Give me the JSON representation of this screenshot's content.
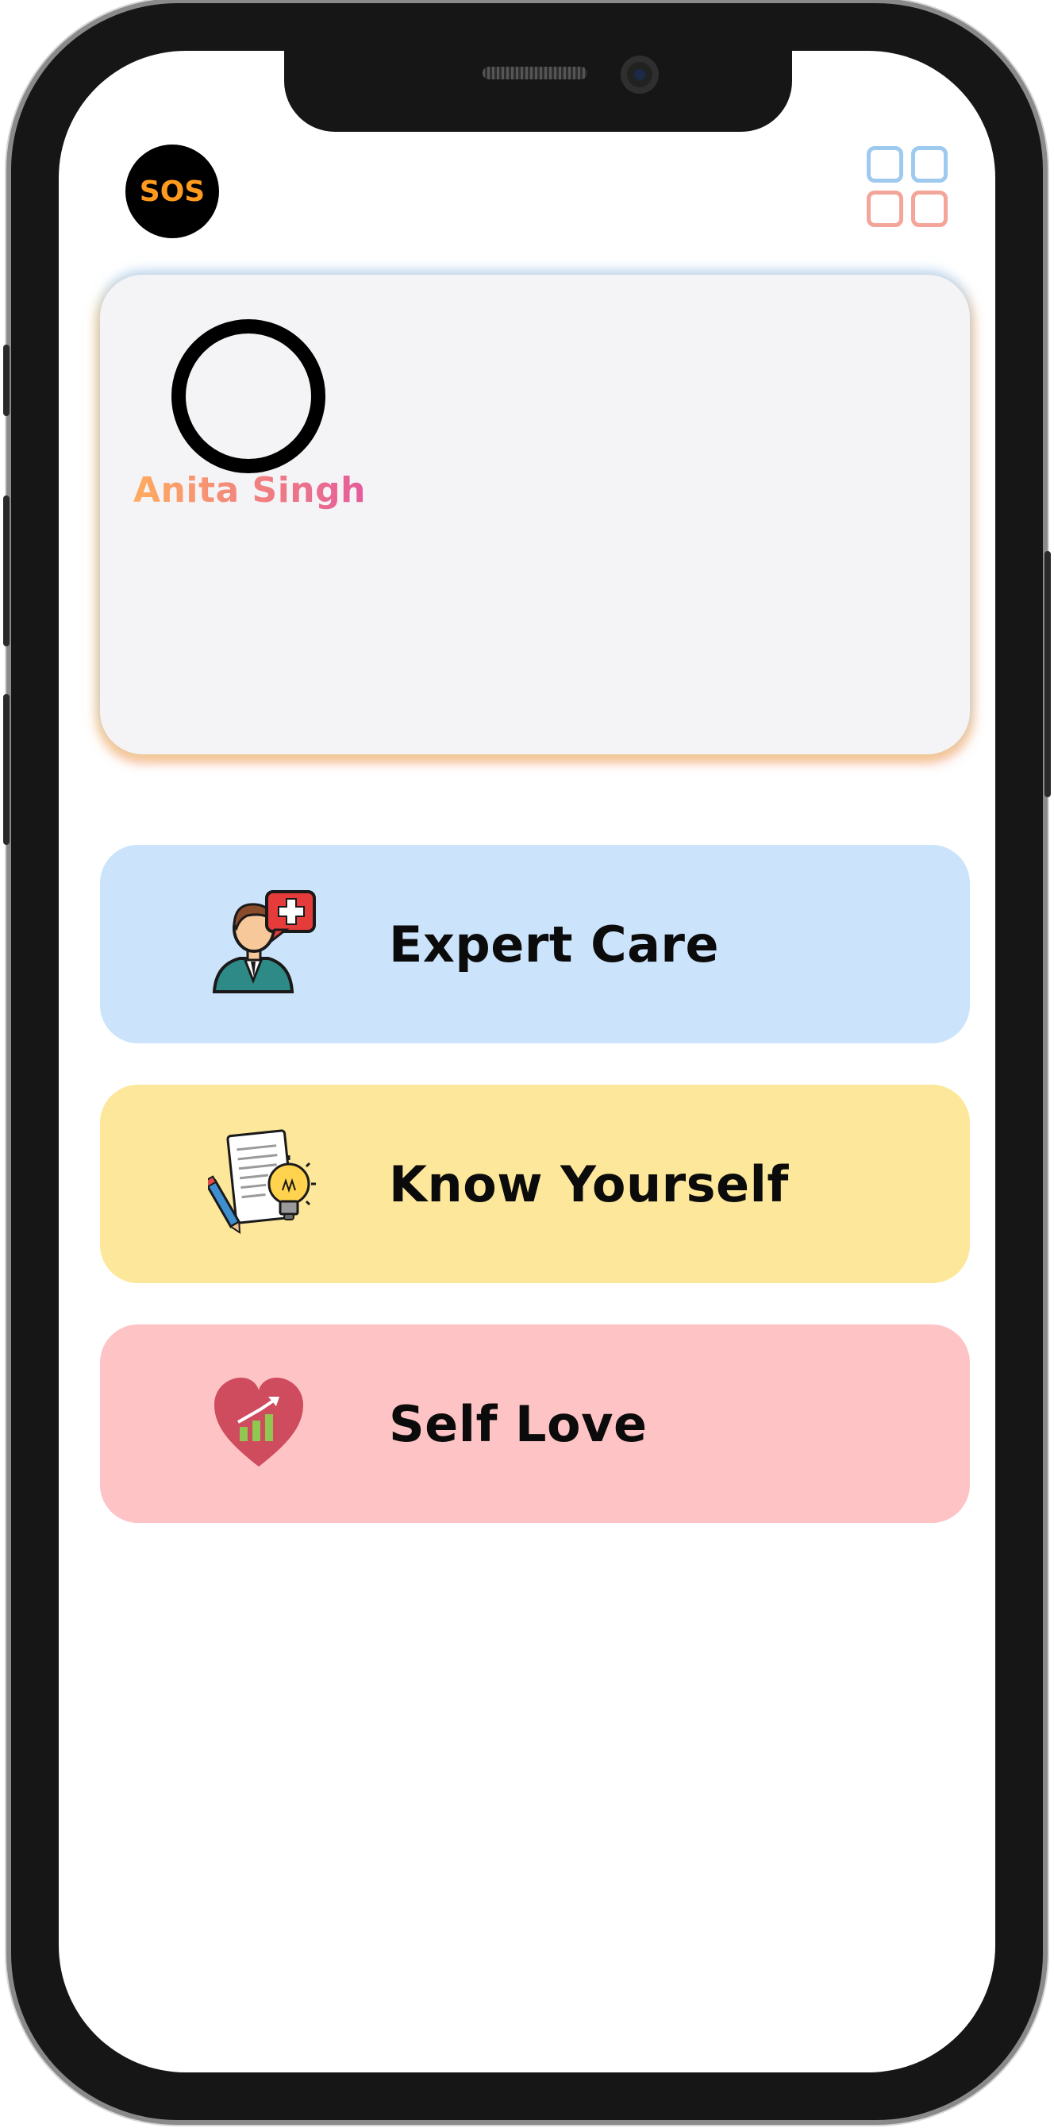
{
  "header": {
    "sos_label": "SOS",
    "menu_icon": "grid-menu-icon"
  },
  "profile": {
    "name": "Anita Singh",
    "avatar_icon": "avatar-ring"
  },
  "features": [
    {
      "label": "Expert Care",
      "icon": "doctor-chat-icon",
      "color": "#cce4fb"
    },
    {
      "label": "Know Yourself",
      "icon": "document-lightbulb-icon",
      "color": "#fde79b"
    },
    {
      "label": "Self Love",
      "icon": "heart-growth-icon",
      "color": "#fec4c5"
    }
  ],
  "colors": {
    "sos_text": "#ff9a1f",
    "name_gradient_start": "#ffac5f",
    "name_gradient_end": "#e45c9c",
    "grid_top": "#9fcaf0",
    "grid_bottom": "#f4a59a"
  }
}
